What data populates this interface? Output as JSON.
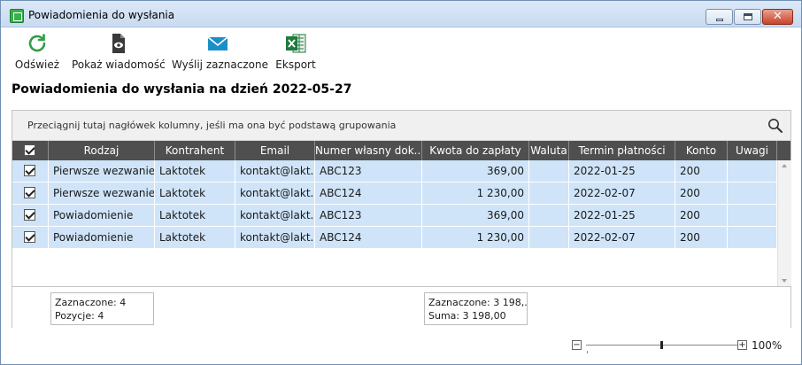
{
  "window": {
    "title": "Powiadomienia do wysłania"
  },
  "toolbar": {
    "refresh": {
      "label": "Odśwież",
      "icon": "refresh-icon"
    },
    "show": {
      "label": "Pokaż wiadomość",
      "icon": "eye-icon"
    },
    "send": {
      "label": "Wyślij zaznaczone",
      "icon": "envelope-icon"
    },
    "export": {
      "label": "Eksport",
      "icon": "excel-icon"
    }
  },
  "heading": "Powiadomienia do wysłania na dzień 2022-05-27",
  "grid": {
    "group_hint": "Przeciągnij tutaj nagłówek kolumny, jeśli ma ona być podstawą grupowania",
    "header_checked": true,
    "columns": [
      {
        "label": "Rodzaj"
      },
      {
        "label": "Kontrahent"
      },
      {
        "label": "Email"
      },
      {
        "label": "Numer własny dok..."
      },
      {
        "label": "Kwota do zapłaty"
      },
      {
        "label": "Waluta"
      },
      {
        "label": "Termin płatności"
      },
      {
        "label": "Konto"
      },
      {
        "label": "Uwagi"
      }
    ],
    "rows": [
      {
        "checked": true,
        "rodzaj": "Pierwsze wezwanie",
        "kontrahent": "Laktotek",
        "email": "kontakt@lakt...",
        "numer": "ABC123",
        "kwota": "369,00",
        "waluta": "",
        "termin": "2022-01-25",
        "konto": "200",
        "uwagi": ""
      },
      {
        "checked": true,
        "rodzaj": "Pierwsze wezwanie",
        "kontrahent": "Laktotek",
        "email": "kontakt@lakt...",
        "numer": "ABC124",
        "kwota": "1 230,00",
        "waluta": "",
        "termin": "2022-02-07",
        "konto": "200",
        "uwagi": ""
      },
      {
        "checked": true,
        "rodzaj": "Powiadomienie",
        "kontrahent": "Laktotek",
        "email": "kontakt@lakt...",
        "numer": "ABC123",
        "kwota": "369,00",
        "waluta": "",
        "termin": "2022-01-25",
        "konto": "200",
        "uwagi": ""
      },
      {
        "checked": true,
        "rodzaj": "Powiadomienie",
        "kontrahent": "Laktotek",
        "email": "kontakt@lakt...",
        "numer": "ABC124",
        "kwota": "1 230,00",
        "waluta": "",
        "termin": "2022-02-07",
        "konto": "200",
        "uwagi": ""
      }
    ],
    "summary_left": {
      "line1": "Zaznaczone: 4",
      "line2": "Pozycje: 4"
    },
    "summary_amount": {
      "line1": "Zaznaczone: 3 198,...",
      "line2": "Suma: 3 198,00"
    }
  },
  "zoom": {
    "minus": "−",
    "plus": "+",
    "value": "100%",
    "level": 100
  }
}
